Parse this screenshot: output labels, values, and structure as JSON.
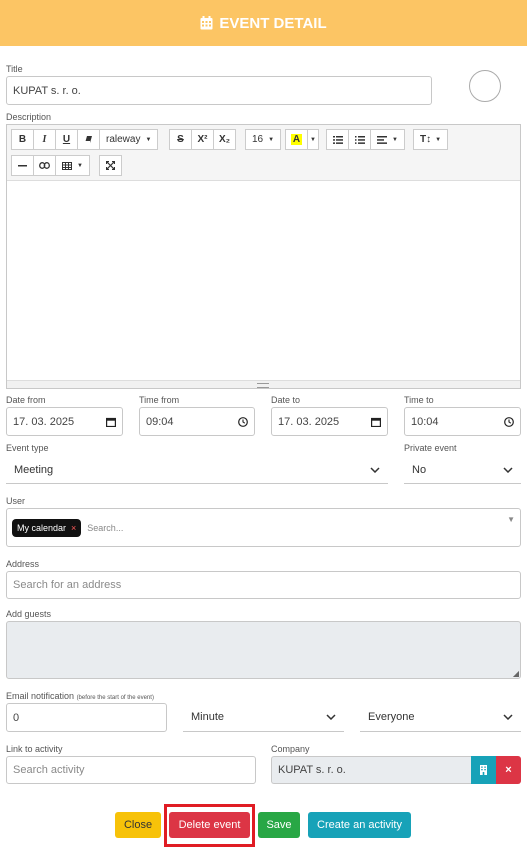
{
  "header": {
    "title": "EVENT DETAIL",
    "icon": "calendar-icon"
  },
  "title_field": {
    "label": "Title",
    "value": "KUPAT s. r. o."
  },
  "description": {
    "label": "Description",
    "toolbar": {
      "bold": "B",
      "italic": "I",
      "underline": "U",
      "font": "raleway",
      "strike": "S",
      "superscript": "X²",
      "subscript": "X₂",
      "size": "16",
      "color": "A",
      "text_size": "T↕"
    }
  },
  "date_from": {
    "label": "Date from",
    "value": "17. 03. 2025"
  },
  "time_from": {
    "label": "Time from",
    "value": "09:04"
  },
  "date_to": {
    "label": "Date to",
    "value": "17. 03. 2025"
  },
  "time_to": {
    "label": "Time to",
    "value": "10:04"
  },
  "event_type": {
    "label": "Event type",
    "value": "Meeting"
  },
  "private_event": {
    "label": "Private event",
    "value": "No"
  },
  "user": {
    "label": "User",
    "tag": "My calendar",
    "tag_remove": "×",
    "placeholder": "Search..."
  },
  "address": {
    "label": "Address",
    "placeholder": "Search for an address"
  },
  "guests": {
    "label": "Add guests"
  },
  "email_notification": {
    "label": "Email notification",
    "sublabel": "(before the start of the event)",
    "value": "0",
    "unit": "Minute",
    "recipients": "Everyone"
  },
  "link_activity": {
    "label": "Link to activity",
    "placeholder": "Search activity"
  },
  "company": {
    "label": "Company",
    "value": "KUPAT s. r. o.",
    "remove": "×"
  },
  "buttons": {
    "close": "Close",
    "delete": "Delete event",
    "save": "Save",
    "create": "Create an activity"
  },
  "colors": {
    "header": "#fcc564",
    "delete": "#dc3545",
    "save": "#28a745",
    "create": "#17a2b8",
    "close": "#f7c209"
  }
}
